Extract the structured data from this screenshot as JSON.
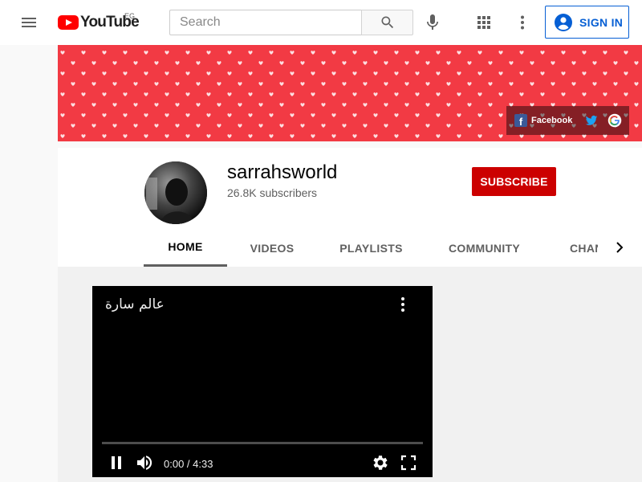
{
  "header": {
    "logo_text": "YouTube",
    "region": "EG",
    "search_placeholder": "Search",
    "signin_label": "SIGN IN"
  },
  "banner": {
    "links": [
      {
        "label": "Facebook",
        "icon": "facebook-icon"
      },
      {
        "label": "",
        "icon": "twitter-icon"
      },
      {
        "label": "",
        "icon": "google-icon"
      }
    ],
    "color": "#f23a44"
  },
  "channel": {
    "name": "sarrahsworld",
    "subscribers": "26.8K subscribers",
    "subscribe_label": "SUBSCRIBE"
  },
  "tabs": [
    {
      "label": "HOME",
      "active": true
    },
    {
      "label": "VIDEOS",
      "active": false
    },
    {
      "label": "PLAYLISTS",
      "active": false
    },
    {
      "label": "COMMUNITY",
      "active": false
    },
    {
      "label": "CHANNELS",
      "active": false
    }
  ],
  "player": {
    "title": "عالم سارة",
    "time": "0:00 / 4:33",
    "progress": 0
  },
  "colors": {
    "accent": "#065fd4",
    "subscribe": "#cc0000",
    "brand": "#ff0000"
  }
}
